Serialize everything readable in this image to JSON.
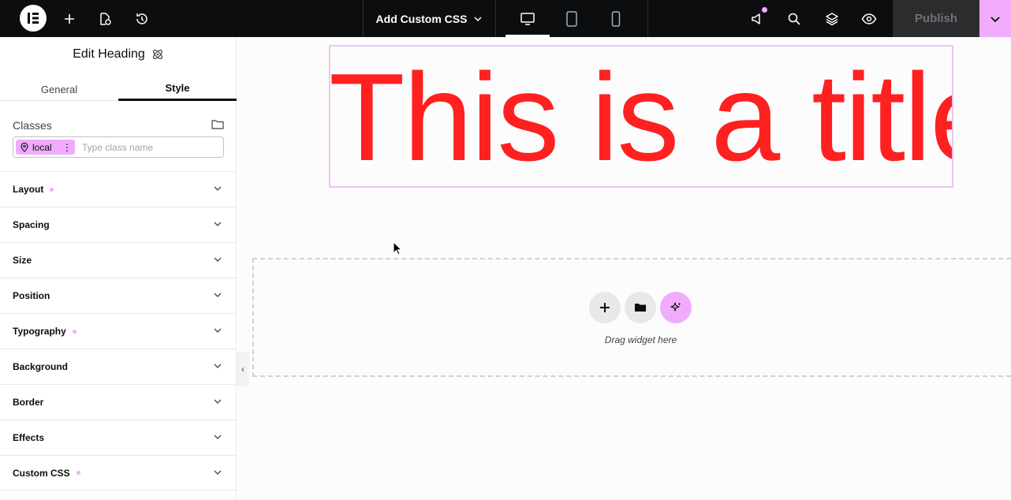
{
  "topbar": {
    "title": "Add Custom CSS",
    "publish_label": "Publish",
    "devices": [
      "desktop",
      "tablet",
      "mobile"
    ],
    "active_device": "desktop",
    "icons": [
      "elementor-logo-icon",
      "plus-icon",
      "page-settings-icon",
      "history-icon",
      "chevron-down-icon",
      "desktop-icon",
      "tablet-icon",
      "mobile-icon",
      "megaphone-icon",
      "search-icon",
      "layers-icon",
      "eye-icon",
      "chevron-down-icon"
    ]
  },
  "panel": {
    "title": "Edit Heading",
    "tabs": [
      {
        "label": "General",
        "active": false
      },
      {
        "label": "Style",
        "active": true
      }
    ],
    "classes": {
      "label": "Classes",
      "chip_label": "local",
      "placeholder": "Type class name"
    },
    "sections": [
      {
        "label": "Layout",
        "modified": true
      },
      {
        "label": "Spacing",
        "modified": false
      },
      {
        "label": "Size",
        "modified": false
      },
      {
        "label": "Position",
        "modified": false
      },
      {
        "label": "Typography",
        "modified": true
      },
      {
        "label": "Background",
        "modified": false
      },
      {
        "label": "Border",
        "modified": false
      },
      {
        "label": "Effects",
        "modified": false
      },
      {
        "label": "Custom CSS",
        "modified": true
      }
    ]
  },
  "canvas": {
    "heading_text": "This is a title",
    "heading_color": "#ff2020",
    "dropzone_text": "Drag widget here"
  },
  "colors": {
    "accent": "#f0abfc",
    "topbar_bg": "#0c0d0e"
  }
}
